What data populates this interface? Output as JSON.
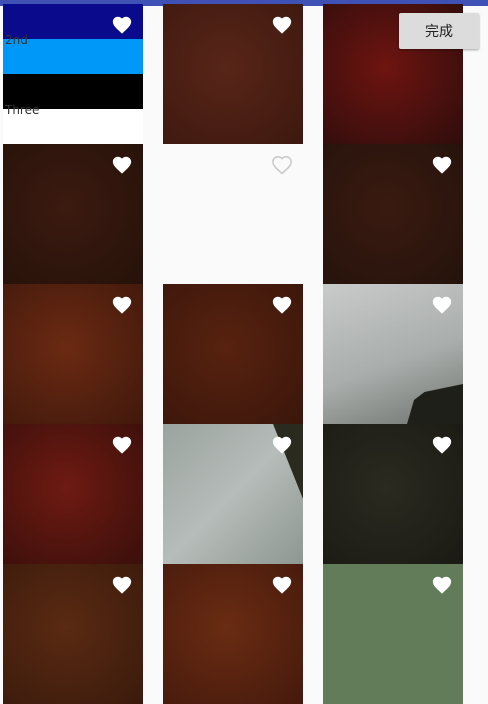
{
  "header": {
    "done_label": "完成"
  },
  "stripe_tile": {
    "stripes": [
      {
        "color": "#0a0a8c",
        "label": ""
      },
      {
        "color": "#0098f8",
        "label": "2nd"
      },
      {
        "color": "#000000",
        "label": ""
      },
      {
        "color": "#ffffff",
        "label": "Three"
      }
    ]
  },
  "photos": [
    {
      "row": 0,
      "col": 0,
      "kind": "stripes",
      "favorite": "filled"
    },
    {
      "row": 0,
      "col": 1,
      "colors": [
        "#582518",
        "#3d180f"
      ],
      "favorite": "filled"
    },
    {
      "row": 0,
      "col": 2,
      "colors": [
        "#6e1410",
        "#2e0d0c"
      ],
      "favorite": "filled"
    },
    {
      "row": 1,
      "col": 0,
      "colors": [
        "#3c1a10",
        "#251209"
      ],
      "favorite": "filled"
    },
    {
      "row": 1,
      "col": 1,
      "colors": [
        "#fafafa",
        "#fafafa"
      ],
      "favorite": "outline"
    },
    {
      "row": 1,
      "col": 2,
      "colors": [
        "#3a1a10",
        "#24130c"
      ],
      "favorite": "filled"
    },
    {
      "row": 2,
      "col": 0,
      "colors": [
        "#6b2a12",
        "#40180c"
      ],
      "favorite": "filled"
    },
    {
      "row": 2,
      "col": 1,
      "colors": [
        "#58220f",
        "#3a160b"
      ],
      "favorite": "filled"
    },
    {
      "row": 2,
      "col": 2,
      "colors": [
        "#bfc2c0",
        "#808684"
      ],
      "favorite": "filled"
    },
    {
      "row": 3,
      "col": 0,
      "colors": [
        "#6e1a12",
        "#3a0f0b"
      ],
      "favorite": "filled"
    },
    {
      "row": 3,
      "col": 1,
      "colors": [
        "#a8b0ad",
        "#6f7a72"
      ],
      "favorite": "filled"
    },
    {
      "row": 3,
      "col": 2,
      "colors": [
        "#2b2a20",
        "#1a1a14"
      ],
      "favorite": "filled"
    },
    {
      "row": 4,
      "col": 0,
      "colors": [
        "#5a2a12",
        "#3a1a0c"
      ],
      "favorite": "filled"
    },
    {
      "row": 4,
      "col": 1,
      "colors": [
        "#6a2c12",
        "#45190c"
      ],
      "favorite": "filled"
    },
    {
      "row": 4,
      "col": 2,
      "colors": [
        "#627c5a",
        "#627c5a"
      ],
      "favorite": "filled"
    }
  ]
}
